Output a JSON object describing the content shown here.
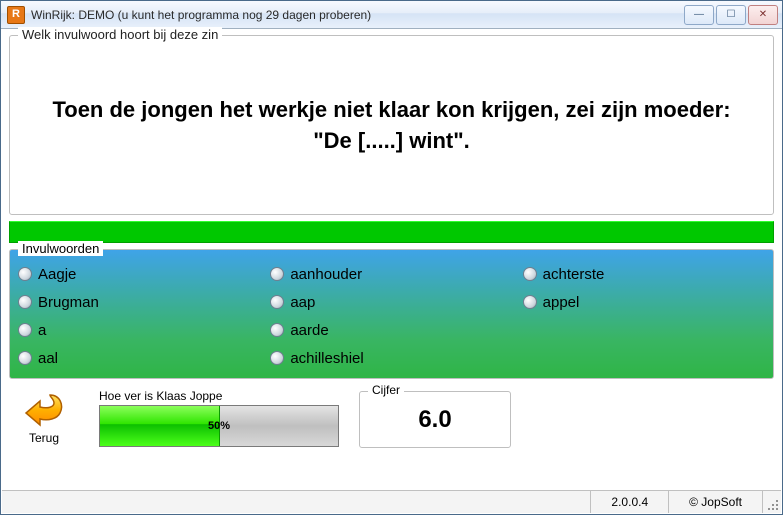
{
  "window": {
    "title": "WinRijk: DEMO (u kunt het programma nog 29 dagen proberen)",
    "app_icon_glyph": "R"
  },
  "question": {
    "legend": "Welk invulwoord hoort bij deze zin",
    "text": "Toen de jongen het werkje niet klaar kon krijgen, zei zijn moeder: \"De [.....] wint\"."
  },
  "answers": {
    "legend": "Invulwoorden",
    "items": [
      "Aagje",
      "aanhouder",
      "achterste",
      "Brugman",
      "aap",
      "appel",
      "a",
      "aarde",
      "",
      "aal",
      "achilleshiel",
      ""
    ]
  },
  "back": {
    "label": "Terug"
  },
  "progress": {
    "label": "Hoe ver is Klaas Joppe",
    "percent_text": "50%",
    "percent_value": 50
  },
  "grade": {
    "legend": "Cijfer",
    "value": "6.0"
  },
  "status": {
    "version": "2.0.0.4",
    "vendor": "© JopSoft"
  }
}
